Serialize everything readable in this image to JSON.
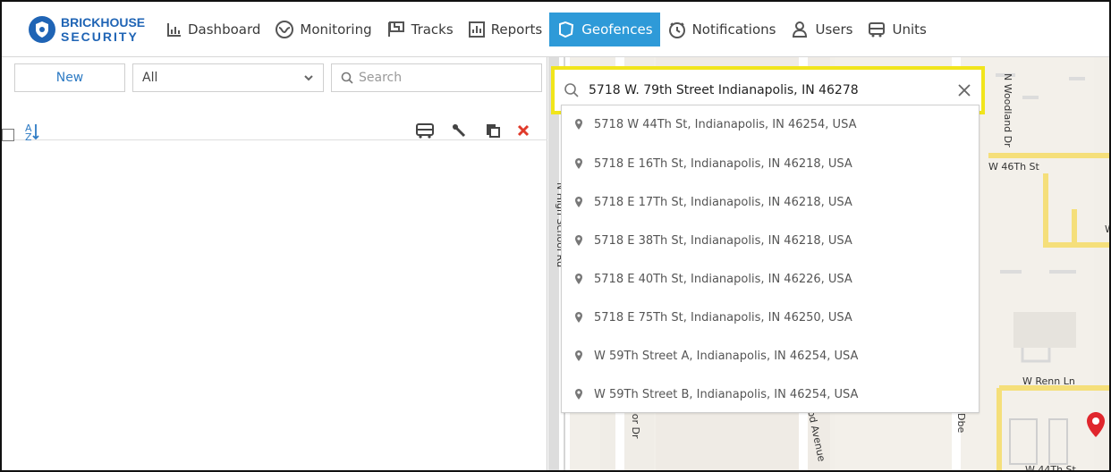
{
  "brand": {
    "top": "BRICKHOUSE",
    "bottom": "SECURITY"
  },
  "nav": {
    "items": [
      {
        "label": "Dashboard"
      },
      {
        "label": "Monitoring"
      },
      {
        "label": "Tracks"
      },
      {
        "label": "Reports"
      },
      {
        "label": "Geofences",
        "active": true
      },
      {
        "label": "Notifications"
      },
      {
        "label": "Users"
      },
      {
        "label": "Units"
      }
    ]
  },
  "left_panel": {
    "new_button": "New",
    "filter_selected": "All",
    "search_placeholder": "Search"
  },
  "map": {
    "search_value": "5718 W. 79th Street Indianapolis, IN 46278",
    "suggestions": [
      "5718 W 44Th St, Indianapolis, IN 46254, USA",
      "5718 E 16Th St, Indianapolis, IN 46218, USA",
      "5718 E 17Th St, Indianapolis, IN 46218, USA",
      "5718 E 38Th St, Indianapolis, IN 46218, USA",
      "5718 E 40Th St, Indianapolis, IN 46226, USA",
      "5718 E 75Th St, Indianapolis, IN 46250, USA",
      "W 59Th Street A, Indianapolis, IN 46254, USA",
      "W 59Th Street B, Indianapolis, IN 46254, USA"
    ],
    "street_labels": {
      "woodland": "N Woodland Dr",
      "w46th": "W 46Th St",
      "high_school": "N High School Rd",
      "w_renn": "W Renn Ln",
      "w44th": "W 44Th St",
      "avenue": "od Avenue",
      "oor_dr": "oor Dr",
      "w_right": "W",
      "dbe": "Dbe"
    }
  },
  "colors": {
    "accent": "#2e9ad8",
    "highlight": "#f1e51b",
    "delete": "#e03a2a"
  }
}
